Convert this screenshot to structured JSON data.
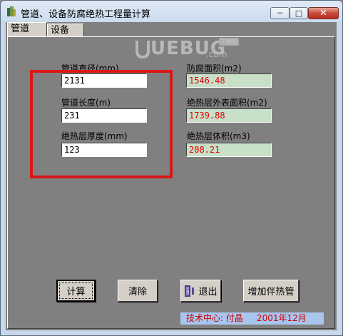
{
  "window": {
    "title": "管道、设备防腐绝热工程量计算"
  },
  "controls": {
    "min": "─",
    "max": "□",
    "close": "✕"
  },
  "tabs": [
    {
      "label": "管道"
    },
    {
      "label": "设备"
    }
  ],
  "watermark": {
    "brand": "UEBUG",
    "domain": ".com",
    "badge": "下载站"
  },
  "inputs": {
    "diameter_label": "管道直径(mm)",
    "diameter_value": "2131",
    "length_label": "管道长度(m)",
    "length_value": "231",
    "thickness_label": "绝热层厚度(mm)",
    "thickness_value": "123"
  },
  "outputs": {
    "anticorrosion_label": "防腐面积(m2)",
    "anticorrosion_value": "1546.48",
    "outer_area_label": "绝热层外表面积(m2)",
    "outer_area_value": "1739.88",
    "volume_label": "绝热层体积(m3)",
    "volume_value": "208.21"
  },
  "buttons": {
    "calculate": "计算",
    "clear": "清除",
    "exit": "退出",
    "add_tracing": "增加伴热管"
  },
  "footer": {
    "info": "技术中心: 付晶     2001年12月"
  },
  "colors": {
    "highlight_box": "#d81818",
    "result_text": "#e00000",
    "result_bg": "#c8e0c8"
  }
}
